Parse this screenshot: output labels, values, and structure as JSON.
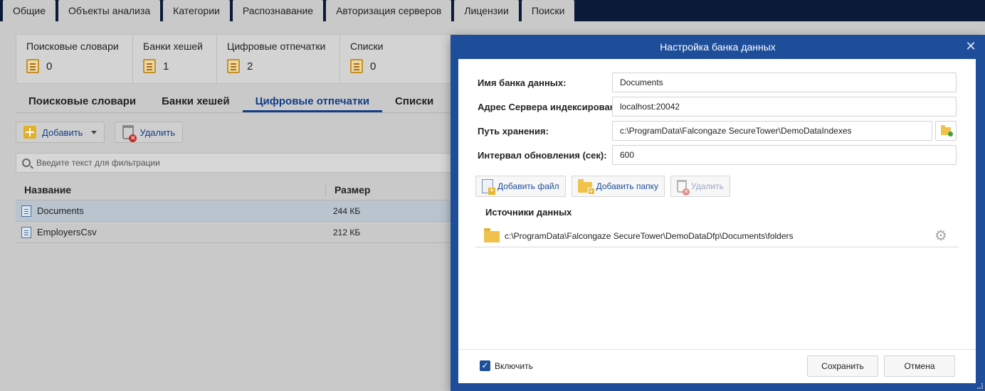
{
  "top_tabs": [
    "Общие",
    "Объекты анализа",
    "Категории",
    "Распознавание",
    "Авторизация серверов",
    "Лицензии",
    "Поиски"
  ],
  "active_top_tab": 1,
  "summary": [
    {
      "label": "Поисковые словари",
      "count": "0"
    },
    {
      "label": "Банки хешей",
      "count": "1"
    },
    {
      "label": "Цифровые отпечатки",
      "count": "2"
    },
    {
      "label": "Списки",
      "count": "0"
    }
  ],
  "sub_tabs": [
    "Поисковые словари",
    "Банки хешей",
    "Цифровые отпечатки",
    "Списки"
  ],
  "active_sub_tab": 2,
  "toolbar": {
    "add_label": "Добавить",
    "delete_label": "Удалить"
  },
  "filter": {
    "placeholder": "Введите текст для фильтрации"
  },
  "table": {
    "headers": [
      "Название",
      "Размер"
    ],
    "rows": [
      {
        "name": "Documents",
        "size": "244 КБ"
      },
      {
        "name": "EmployersCsv",
        "size": "212 КБ"
      }
    ]
  },
  "dialog": {
    "title": "Настройка банка данных",
    "fields": [
      {
        "label": "Имя банка данных:",
        "value": "Documents"
      },
      {
        "label": "Адрес Сервера индексирования:",
        "value": "localhost:20042"
      },
      {
        "label": "Путь хранения:",
        "value": "c:\\ProgramData\\Falcongaze SecureTower\\DemoDataIndexes"
      },
      {
        "label": "Интервал обновления (сек):",
        "value": "600"
      }
    ],
    "add_file_label": "Добавить файл",
    "add_folder_label": "Добавить папку",
    "delete_label": "Удалить",
    "sources_title": "Источники данных",
    "sources": [
      "c:\\ProgramData\\Falcongaze SecureTower\\DemoDataDfp\\Documents\\folders"
    ],
    "enable_label": "Включить",
    "enabled": true,
    "save_label": "Сохранить",
    "cancel_label": "Отмена"
  },
  "colors": {
    "accent": "#1e4e9a",
    "topbar": "#0c1a3a"
  }
}
